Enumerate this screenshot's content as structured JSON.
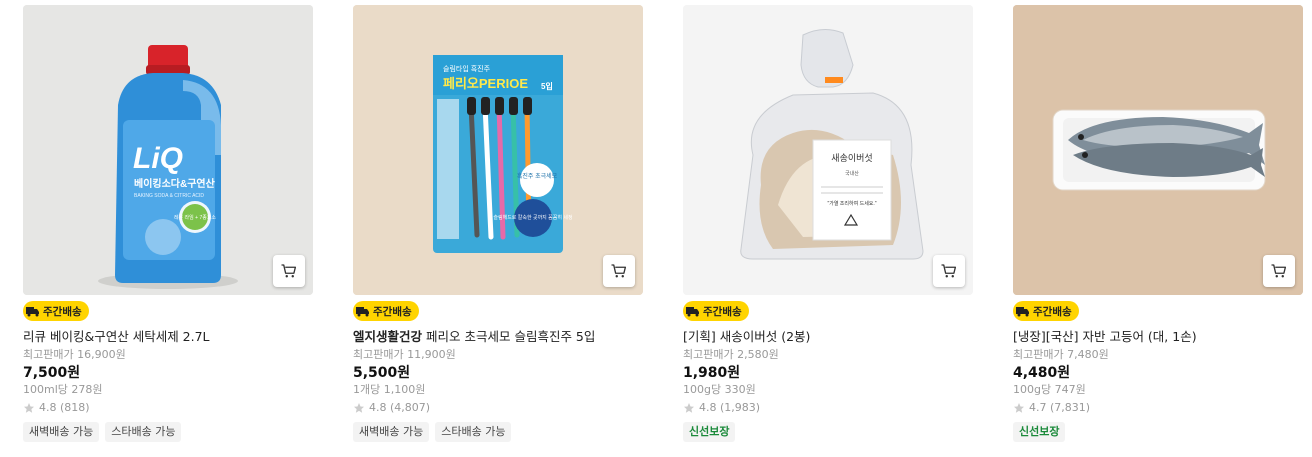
{
  "badge_label": "주간배송",
  "products": [
    {
      "brand": "",
      "name": "리큐 베이킹&구연산 세탁세제 2.7L",
      "original_price": "최고판매가 16,900원",
      "price": "7,500원",
      "unit_price": "100ml당 278원",
      "rating": "4.8 (818)",
      "tags": [
        "새벽배송 가능",
        "스타배송 가능"
      ],
      "image": {
        "bg": "#e4e4e2",
        "brand_text": "LiQ",
        "label_text": "베이킹소다&구연산",
        "label_sub": "BAKING SODA & CITRIC ACID",
        "circle_text": "레몬 라임 + 7종효소"
      }
    },
    {
      "brand": "엘지생활건강",
      "name": "페리오 초극세모 슬림흑진주 5입",
      "original_price": "최고판매가 11,900원",
      "price": "5,500원",
      "unit_price": "1개당 1,100원",
      "rating": "4.8 (4,807)",
      "tags": [
        "새벽배송 가능",
        "스타배송 가능"
      ],
      "image": {
        "bg": "#eadbc8",
        "top_text": "슬림타입 흑진주",
        "brand_text": "페리오PERIOE",
        "count_text": "5입",
        "bubble_text": "흑진주 초극세모",
        "bottom_text": "슬림헤드로 칼숙한 곳까지 꼼꼼히 세정"
      }
    },
    {
      "brand": "",
      "name": "[기획] 새송이버섯 (2봉)",
      "original_price": "최고판매가 2,580원",
      "price": "1,980원",
      "unit_price": "100g당 330원",
      "rating": "4.8 (1,983)",
      "tags": [
        "신선보장"
      ],
      "image": {
        "bg": "#f4f4f4",
        "label_title": "새송이버섯",
        "label_origin": "국내산",
        "label_note": "\"가열 조리하여 드세요.\""
      }
    },
    {
      "brand": "",
      "name": "[냉장][국산] 자반 고등어 (대, 1손)",
      "original_price": "최고판매가 7,480원",
      "price": "4,480원",
      "unit_price": "100g당 747원",
      "rating": "4.7 (7,831)",
      "tags": [
        "신선보장"
      ],
      "image": {
        "bg": "#dcc3a9"
      }
    }
  ],
  "colors": {
    "badge": "#ffd400",
    "fresh_tag": "#1a8a3a",
    "star": "#cccccc"
  },
  "icons": {
    "cart": "cart-icon",
    "truck": "truck-icon",
    "star": "star-icon"
  }
}
